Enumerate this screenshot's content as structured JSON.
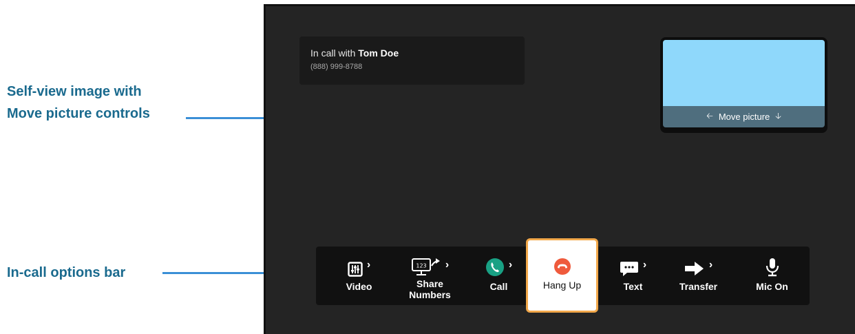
{
  "annotations": {
    "selfview_line1": "Self-view image with",
    "selfview_line2": "Move picture controls",
    "options_bar": "In-call options bar"
  },
  "call_info": {
    "prefix": "In call with ",
    "name": "Tom Doe",
    "number": "(888) 999-8788"
  },
  "selfview": {
    "move_label": "Move picture"
  },
  "options": {
    "video": "Video",
    "share_line1": "Share",
    "share_line2": "Numbers",
    "call": "Call",
    "hangup": "Hang Up",
    "text": "Text",
    "transfer": "Transfer",
    "mic": "Mic On"
  },
  "colors": {
    "annotation": "#1a6a8e",
    "pointer": "#3a8fd6",
    "call_green": "#19a184",
    "hangup_red": "#ef5a3c",
    "hangup_border": "#f2a84a",
    "selfview_blue": "#8fd8fb"
  }
}
